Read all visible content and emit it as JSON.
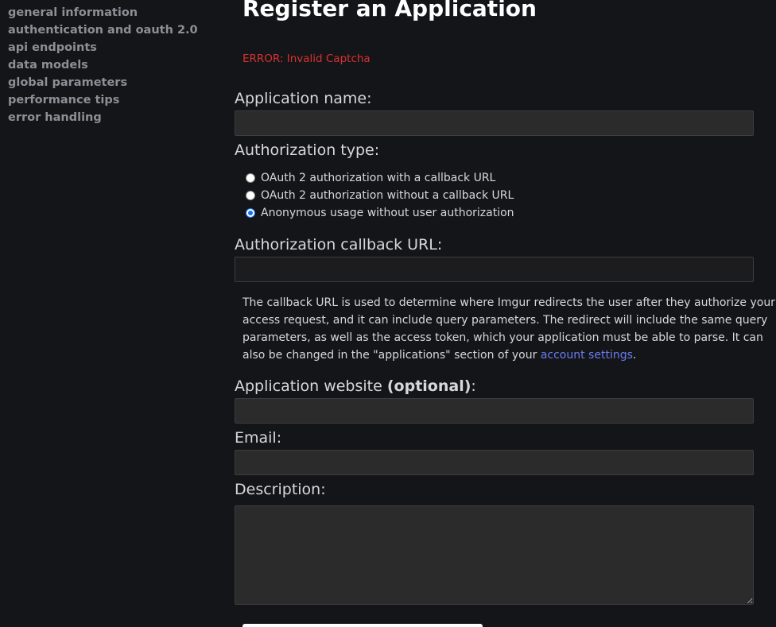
{
  "sidebar": {
    "items": [
      {
        "label": "general information"
      },
      {
        "label": "authentication and oauth 2.0"
      },
      {
        "label": "api endpoints"
      },
      {
        "label": "data models"
      },
      {
        "label": "global parameters"
      },
      {
        "label": "performance tips"
      },
      {
        "label": "error handling"
      }
    ]
  },
  "main": {
    "title": "Register an Application",
    "error": "ERROR: Invalid Captcha",
    "application_name": {
      "label": "Application name:",
      "value": ""
    },
    "authorization_type": {
      "label": "Authorization type:",
      "options": [
        {
          "label": "OAuth 2 authorization with a callback URL",
          "checked": false
        },
        {
          "label": "OAuth 2 authorization without a callback URL",
          "checked": false
        },
        {
          "label": "Anonymous usage without user authorization",
          "checked": true
        }
      ]
    },
    "callback_url": {
      "label": "Authorization callback URL:",
      "value": "",
      "help_text": "The callback URL is used to determine where Imgur redirects the user after they authorize your access request, and it can include query parameters. The redirect will include the same query parameters, as well as the access token, which your application must be able to parse. It can also be changed in the \"applications\" section of your ",
      "help_link": "account settings",
      "help_suffix": "."
    },
    "website": {
      "label": "Application website ",
      "label_optional": "(optional)",
      "label_suffix": ":",
      "value": ""
    },
    "email": {
      "label": "Email:",
      "value": ""
    },
    "description": {
      "label": "Description:",
      "value": ""
    }
  },
  "colors": {
    "background": "#141518",
    "sidebar_text": "#8c8f96",
    "error": "#d93131",
    "link": "#6b7df2",
    "input_bg": "#2b2b2b"
  }
}
